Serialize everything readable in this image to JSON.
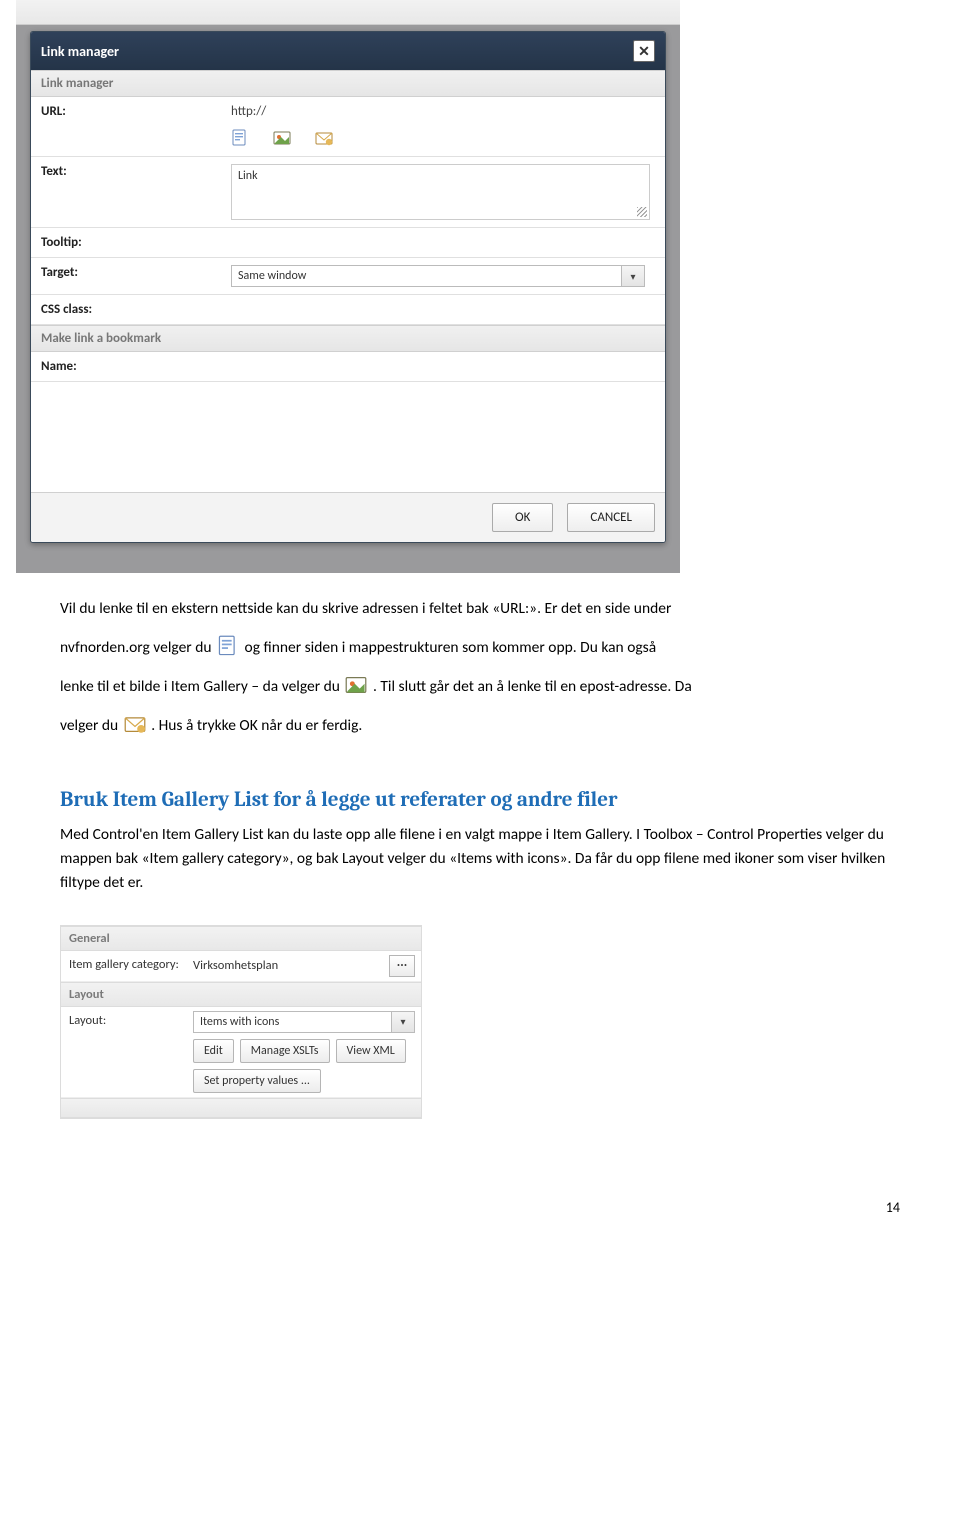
{
  "dialog": {
    "title": "Link manager",
    "close_glyph": "✕",
    "section1": "Link manager",
    "url_label": "URL:",
    "url_value": "http://",
    "text_label": "Text:",
    "text_value": "Link",
    "tooltip_label": "Tooltip:",
    "target_label": "Target:",
    "target_value": "Same window",
    "css_label": "CSS class:",
    "section2": "Make link a bookmark",
    "name_label": "Name:",
    "ok": "OK",
    "cancel": "CANCEL"
  },
  "body": {
    "p1a": "Vil du lenke til en ekstern nettside kan du skrive adressen i feltet bak «URL:». Er det en side under",
    "p2a": "nvfnorden.org velger du ",
    "p2b": " og finner siden i mappestrukturen som kommer opp. Du kan også",
    "p3a": "lenke til et bilde i Item Gallery – da velger du ",
    "p3b": ". Til slutt går det an å lenke til en epost-adresse. Da",
    "p4a": "velger du ",
    "p4b": ". Hus å trykke OK når du er ferdig.",
    "h2": "Bruk Item Gallery List for å legge ut referater og andre filer",
    "p5": "Med Control'en Item Gallery List kan du laste opp alle filene i en valgt mappe i Item Gallery. I Toolbox – Control  Properties velger du mappen bak «Item gallery category», og bak Layout velger du «Items with icons». Da får du opp filene med ikoner som viser hvilken filtype det er."
  },
  "props": {
    "cat_general": "General",
    "igc_label": "Item gallery category:",
    "igc_value": "Virksomhetsplan",
    "cat_layout": "Layout",
    "layout_label": "Layout:",
    "layout_value": "Items with icons",
    "edit": "Edit",
    "manage": "Manage XSLTs",
    "viewxml": "View XML",
    "setprops": "Set property values ..."
  },
  "page_num": "14"
}
